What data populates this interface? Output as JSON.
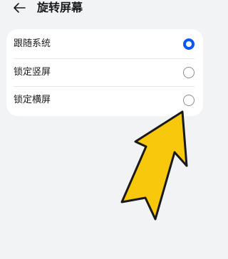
{
  "header": {
    "back_icon": "back-arrow-icon",
    "title": "旋转屏幕"
  },
  "options": [
    {
      "label": "跟随系统",
      "selected": true
    },
    {
      "label": "锁定竖屏",
      "selected": false
    },
    {
      "label": "锁定横屏",
      "selected": false
    }
  ],
  "colors": {
    "background": "#f1f3f5",
    "card": "#ffffff",
    "accent": "#0a59f7",
    "pointer_fill": "#f7c80c",
    "pointer_stroke": "#1a1a1a"
  },
  "annotation": {
    "icon": "pointer-arrow-icon",
    "target": "锁定横屏"
  }
}
